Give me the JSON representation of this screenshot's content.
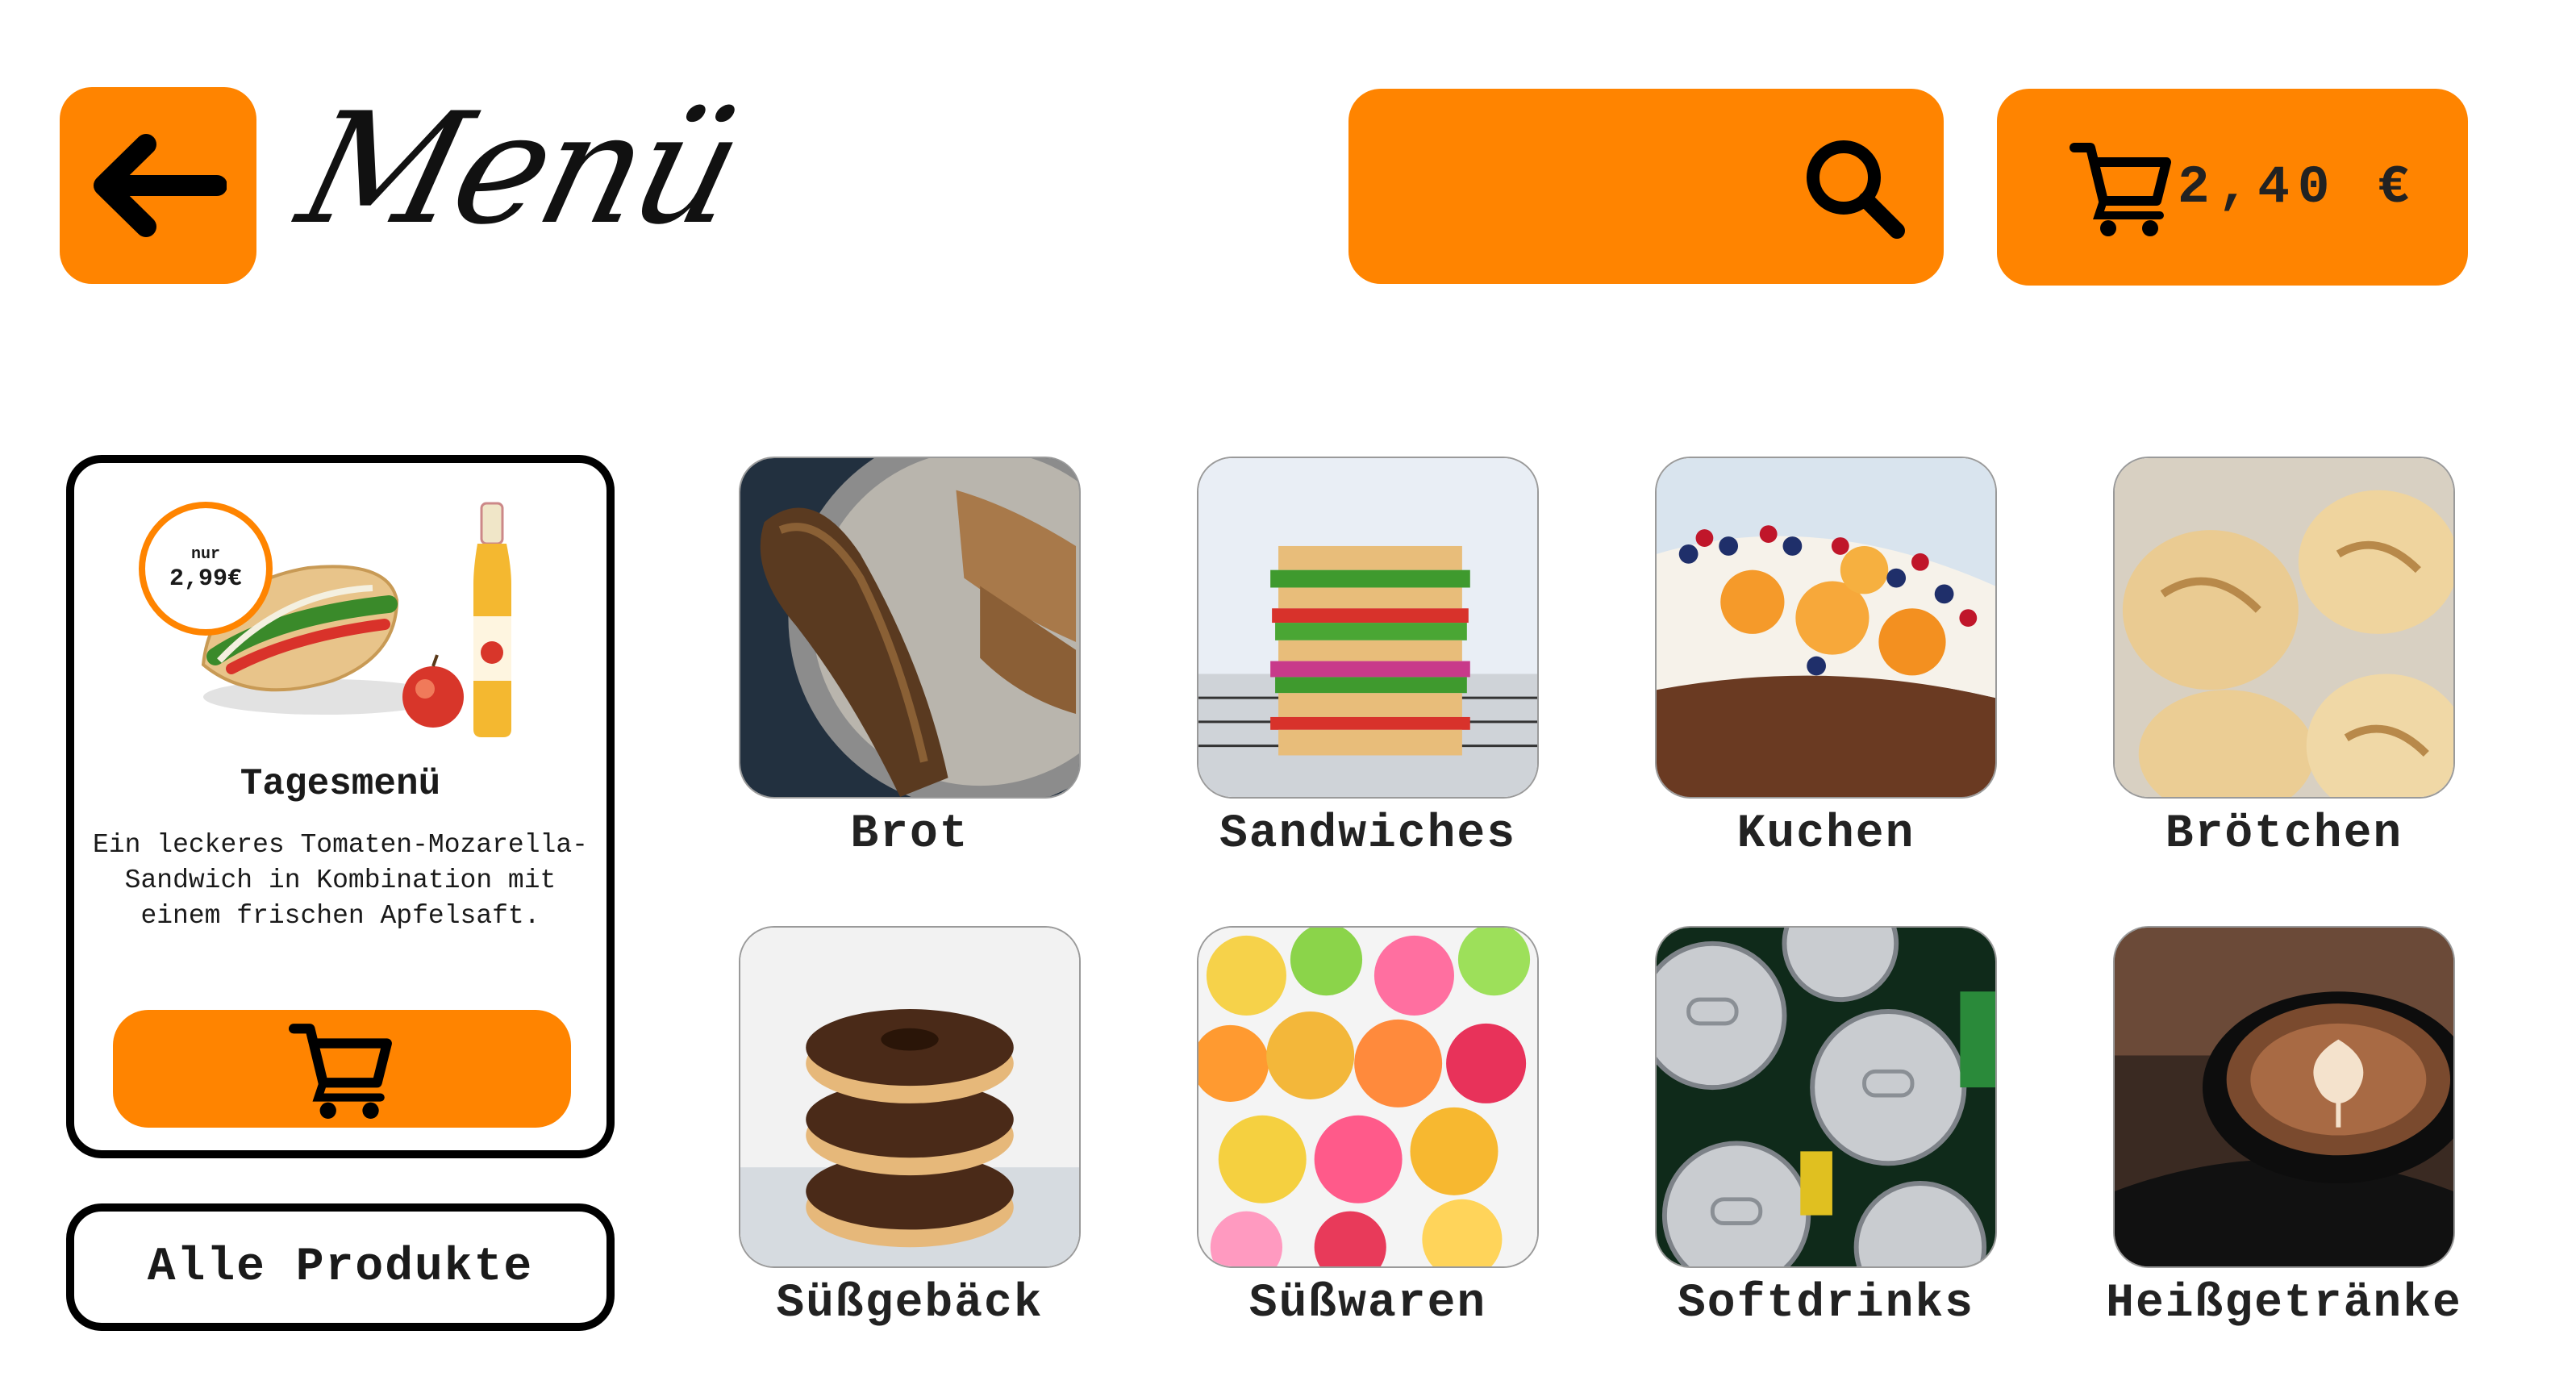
{
  "header": {
    "back_icon": "arrow-left-icon",
    "title": "Menü",
    "search_icon": "search-icon",
    "cart_icon": "cart-icon",
    "cart_total": "2,40 €"
  },
  "daily_menu": {
    "badge_prefix": "nur",
    "badge_price": "2,99€",
    "title": "Tagesmenü",
    "description": "Ein leckeres Tomaten-Mozarella-Sandwich in Kombination mit einem frischen Apfelsaft.",
    "cart_icon": "cart-icon"
  },
  "all_products_label": "Alle Produkte",
  "categories": [
    {
      "label": "Brot"
    },
    {
      "label": "Sandwiches"
    },
    {
      "label": "Kuchen"
    },
    {
      "label": "Brötchen"
    },
    {
      "label": "Süßgebäck"
    },
    {
      "label": "Süßwaren"
    },
    {
      "label": "Softdrinks"
    },
    {
      "label": "Heißgetränke"
    }
  ],
  "colors": {
    "accent": "#ff8400",
    "text": "#1a1a1a",
    "border": "#000000"
  }
}
